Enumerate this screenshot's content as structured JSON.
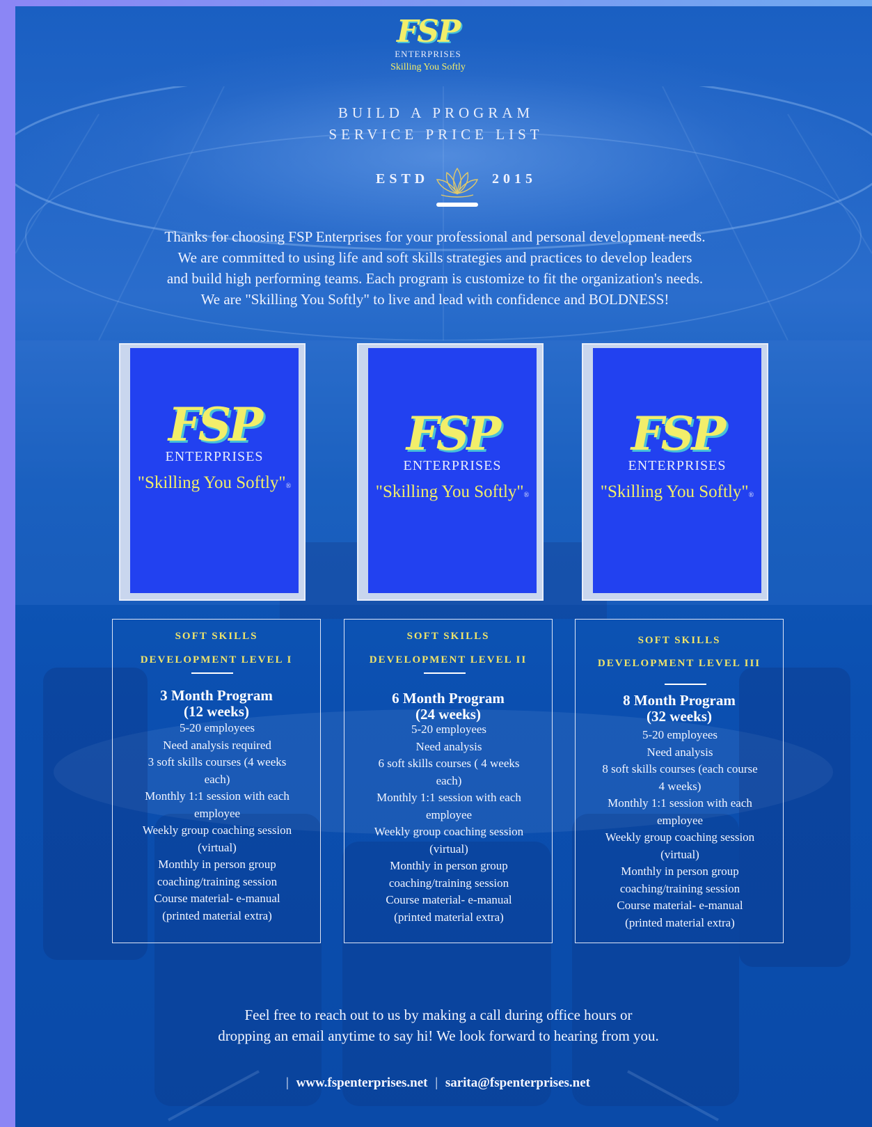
{
  "header": {
    "logo_monogram": "FSP",
    "logo_enterprises": "ENTERPRISES",
    "logo_tagline": "Skilling You Softly",
    "title_line1": "BUILD A PROGRAM",
    "title_line2": "SERVICE PRICE LIST",
    "estd": "ESTD",
    "year": "2015",
    "icon": "lotus-icon"
  },
  "intro": [
    "Thanks for choosing FSP Enterprises for your professional and personal development needs.",
    "We are committed to using life and soft skills strategies and practices to develop leaders",
    "and build high performing teams. Each program is customize to fit the organization's needs.",
    "We are \"Skilling You Softly\" to live and lead with confidence and BOLDNESS!"
  ],
  "book_cover": {
    "monogram": "FSP",
    "enterprises": "ENTERPRISES",
    "tagline": "\"Skilling You Softly\"",
    "registered": "®"
  },
  "programs": [
    {
      "level_line1": "SOFT SKILLS",
      "level_line2": "DEVELOPMENT LEVEL I",
      "program_line1": "3 Month Program",
      "program_line2": "(12 weeks)",
      "features": [
        "5-20 employees",
        "Need analysis required",
        "3 soft skills courses (4 weeks",
        "each)",
        "Monthly 1:1 session with each",
        "employee",
        "Weekly group coaching session",
        "(virtual)",
        "Monthly in person group",
        "coaching/training session",
        "Course material- e-manual",
        "(printed material extra)"
      ]
    },
    {
      "level_line1": "SOFT SKILLS",
      "level_line2": "DEVELOPMENT LEVEL II",
      "program_line1": "6 Month Program",
      "program_line2": "(24 weeks)",
      "features": [
        "5-20 employees",
        "Need analysis",
        "6 soft skills courses ( 4 weeks",
        "each)",
        "Monthly 1:1 session with each",
        "employee",
        "Weekly group coaching session",
        "(virtual)",
        "Monthly in person group",
        "coaching/training session",
        "Course material- e-manual",
        "(printed material extra)"
      ]
    },
    {
      "level_line1": "SOFT SKILLS",
      "level_line2": "DEVELOPMENT LEVEL III",
      "program_line1": "8 Month Program",
      "program_line2": "(32 weeks)",
      "features": [
        "5-20 employees",
        "Need analysis",
        "8 soft skills courses (each course",
        "4 weeks)",
        "Monthly 1:1 session with each",
        "employee",
        "Weekly group coaching session",
        "(virtual)",
        "Monthly in person group",
        "coaching/training session",
        "Course material- e-manual",
        "(printed material extra)"
      ]
    }
  ],
  "outro": [
    "Feel free to reach out to us by making a call during office hours or",
    "dropping an email anytime to say hi! We look forward to hearing from you."
  ],
  "contact": {
    "separator": "|",
    "website": "www.fspenterprises.net",
    "email": "sarita@fspenterprises.net"
  },
  "colors": {
    "accent_yellow": "#f2ee6a",
    "cover_blue": "#2241f0",
    "background_blue": "#0b4fb0",
    "side_strip": "#8b86f5"
  }
}
